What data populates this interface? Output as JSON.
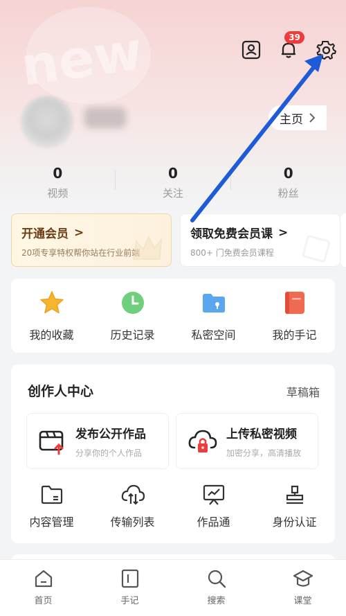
{
  "header": {
    "notification_count": "39",
    "homepage_label": "主页"
  },
  "stats": [
    {
      "value": "0",
      "label": "视频"
    },
    {
      "value": "0",
      "label": "关注"
    },
    {
      "value": "0",
      "label": "粉丝"
    }
  ],
  "vip": {
    "membership": {
      "title": "开通会员",
      "chevron": ">",
      "subtitle": "20项专享特权帮你站在行业前端"
    },
    "free_course": {
      "title": "领取免费会员课",
      "chevron": ">",
      "subtitle": "800+ 门免费会员课程"
    }
  },
  "quick_actions": [
    {
      "label": "我的收藏",
      "icon": "star-icon",
      "color": "#f6b52e"
    },
    {
      "label": "历史记录",
      "icon": "clock-icon",
      "color": "#6fcf7c"
    },
    {
      "label": "私密空间",
      "icon": "folder-lock-icon",
      "color": "#5aa6f0"
    },
    {
      "label": "我的手记",
      "icon": "notebook-icon",
      "color": "#f06a52"
    }
  ],
  "creator": {
    "title": "创作人中心",
    "drafts_label": "草稿箱",
    "publish_public": {
      "title": "发布公开作品",
      "subtitle": "分享你的个人作品"
    },
    "upload_private": {
      "title": "上传私密视频",
      "subtitle": "加密分享，高清播放"
    },
    "tools": [
      {
        "label": "内容管理",
        "icon": "folder-icon"
      },
      {
        "label": "传输列表",
        "icon": "cloud-transfer-icon"
      },
      {
        "label": "作品通",
        "icon": "presentation-icon"
      },
      {
        "label": "身份认证",
        "icon": "stamp-icon"
      }
    ]
  },
  "tabbar": [
    {
      "label": "首页",
      "icon": "home-icon"
    },
    {
      "label": "手记",
      "icon": "note-icon"
    },
    {
      "label": "搜索",
      "icon": "search-icon"
    },
    {
      "label": "课堂",
      "icon": "graduation-cap-icon"
    }
  ],
  "colors": {
    "accent_red": "#ee3b3b",
    "annotation_arrow": "#1d5bd8",
    "vip_gold": "#6b3d14"
  }
}
